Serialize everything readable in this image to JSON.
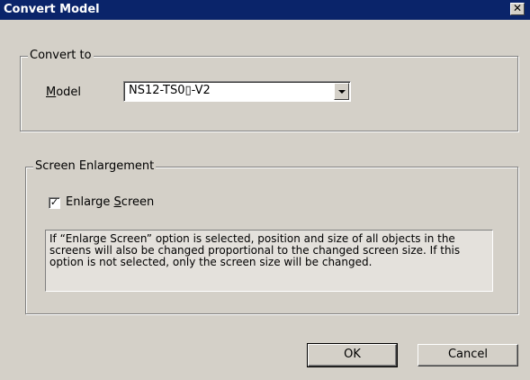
{
  "window": {
    "title": "Convert Model",
    "close_glyph": "✕"
  },
  "convert_to": {
    "legend": "Convert to",
    "model_label_mnemonic": "M",
    "model_label_rest": "odel",
    "model_value": "NS12-TS0▯-V2"
  },
  "screen_enlargement": {
    "legend": "Screen Enlargement",
    "checkbox_checked": true,
    "checkbox_mark": "✓",
    "checkbox_label_prefix": "Enlarge ",
    "checkbox_label_mnemonic": "S",
    "checkbox_label_rest": "creen",
    "info_text": "If “Enlarge Screen” option is selected, position and size of all objects in the screens will also be changed proportional to the changed screen size. If this option is not selected, only the screen size will be changed."
  },
  "buttons": {
    "ok": "OK",
    "cancel": "Cancel"
  },
  "icons": {
    "close": "close-icon",
    "dropdown": "chevron-down-icon",
    "check": "checkmark-icon"
  }
}
